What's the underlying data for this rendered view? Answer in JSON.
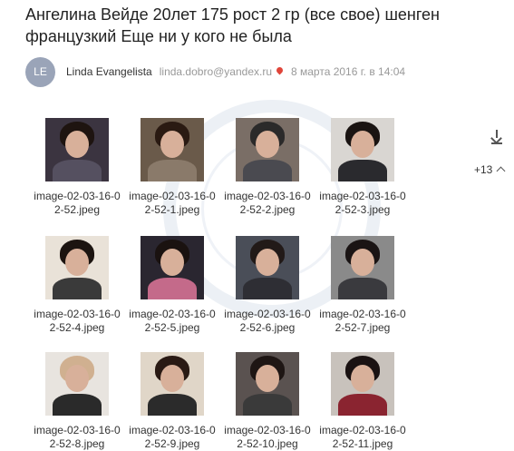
{
  "email": {
    "subject": "Ангелина Вейде 20лет 175 рост 2 гр (все свое) шенген французкий Еще ни у кого не была",
    "sender": {
      "initials": "LE",
      "name": "Linda Evangelista",
      "email": "linda.dobro@yandex.ru",
      "date": "8 марта 2016 г. в 14:04"
    }
  },
  "attachments": {
    "more_label": "+13",
    "items": [
      {
        "name": "image-02-03-16-02-52.jpeg",
        "bg": "#3b3440",
        "hair": "#1e1410",
        "body": "#555060"
      },
      {
        "name": "image-02-03-16-02-52-1.jpeg",
        "bg": "#6a5a4a",
        "hair": "#2a1a12",
        "body": "#8a7a6a"
      },
      {
        "name": "image-02-03-16-02-52-2.jpeg",
        "bg": "#7a6e66",
        "hair": "#2b2a2a",
        "body": "#4a4a50"
      },
      {
        "name": "image-02-03-16-02-52-3.jpeg",
        "bg": "#d9d6d2",
        "hair": "#1a1412",
        "body": "#2a2a2e"
      },
      {
        "name": "image-02-03-16-02-52-4.jpeg",
        "bg": "#e9e2d8",
        "hair": "#1c1410",
        "body": "#3a3a3a"
      },
      {
        "name": "image-02-03-16-02-52-5.jpeg",
        "bg": "#2a2630",
        "hair": "#1a1210",
        "body": "#c46a8a"
      },
      {
        "name": "image-02-03-16-02-52-6.jpeg",
        "bg": "#4a4e58",
        "hair": "#221a18",
        "body": "#2e2e34"
      },
      {
        "name": "image-02-03-16-02-52-7.jpeg",
        "bg": "#8a8a8a",
        "hair": "#1a1414",
        "body": "#3a3a3e"
      },
      {
        "name": "image-02-03-16-02-52-8.jpeg",
        "bg": "#e8e4df",
        "hair": "#d0b090",
        "body": "#2a2a2a"
      },
      {
        "name": "image-02-03-16-02-52-9.jpeg",
        "bg": "#e0d6c8",
        "hair": "#2a1a14",
        "body": "#2b2b2b"
      },
      {
        "name": "image-02-03-16-02-52-10.jpeg",
        "bg": "#5a5250",
        "hair": "#1e1614",
        "body": "#3a3a3a"
      },
      {
        "name": "image-02-03-16-02-52-11.jpeg",
        "bg": "#c8c2bc",
        "hair": "#1a1212",
        "body": "#8a2430"
      }
    ]
  },
  "colors": {
    "avatar": "#9aa4b8",
    "text": "#222222",
    "muted": "#999999",
    "pin": "#e0453a"
  },
  "icons": [
    "location-pin-icon",
    "download-icon",
    "chevron-up-icon"
  ]
}
